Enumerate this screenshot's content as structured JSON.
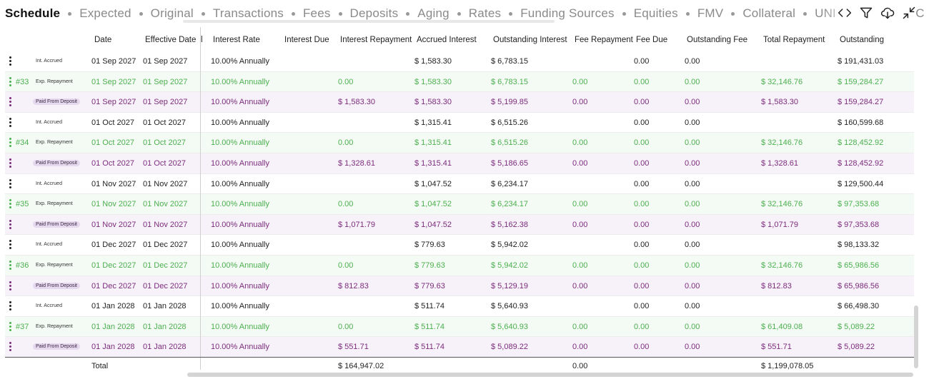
{
  "tabs": [
    {
      "label": "Schedule",
      "active": true
    },
    {
      "label": "Expected"
    },
    {
      "label": "Original"
    },
    {
      "label": "Transactions"
    },
    {
      "label": "Fees"
    },
    {
      "label": "Deposits"
    },
    {
      "label": "Aging"
    },
    {
      "label": "Rates"
    },
    {
      "label": "Funding Sources"
    },
    {
      "label": "Equities"
    },
    {
      "label": "FMV"
    },
    {
      "label": "Collateral"
    },
    {
      "label": "UNDERWRITING C"
    }
  ],
  "tools": [
    {
      "name": "code-view-icon"
    },
    {
      "name": "filter-icon"
    },
    {
      "name": "cloud-download-icon"
    },
    {
      "name": "collapse-icon"
    }
  ],
  "columns": {
    "date": "Date",
    "effective_date": "Effective Date",
    "partial": "l",
    "interest_rate": "Interest Rate",
    "interest_due": "Interest Due",
    "interest_repayment": "Interest Repayment",
    "accrued_interest": "Accrued Interest",
    "outstanding_interest": "Outstanding Interest",
    "fee_repayment": "Fee Repayment",
    "fee_due": "Fee Due",
    "outstanding_fee": "Outstanding Fee",
    "total_repayment": "Total Repayment",
    "outstanding": "Outstanding"
  },
  "badges": {
    "accrued": "Int. Accrued",
    "expected": "Exp. Repayment",
    "paid": "Paid From Deposit"
  },
  "rows": [
    {
      "type": "accrued",
      "num": "",
      "date": "01 Sep 2027",
      "eff": "01 Sep 2027",
      "rate": "10.00% Annually",
      "int_due": "",
      "int_repay": "",
      "accrued": "$ 1,583.30",
      "out_int": "$ 6,783.15",
      "fee_repay": "",
      "fee_due": "0.00",
      "out_fee": "0.00",
      "total_repay": "",
      "outstanding": "$ 191,431.03"
    },
    {
      "type": "expected",
      "num": "#33",
      "date": "01 Sep 2027",
      "eff": "01 Sep 2027",
      "rate": "10.00% Annually",
      "int_due": "",
      "int_repay": "0.00",
      "accrued": "$ 1,583.30",
      "out_int": "$ 6,783.15",
      "fee_repay": "0.00",
      "fee_due": "0.00",
      "out_fee": "0.00",
      "total_repay": "$ 32,146.76",
      "outstanding": "$ 159,284.27"
    },
    {
      "type": "paid",
      "num": "",
      "date": "01 Sep 2027",
      "eff": "01 Sep 2027",
      "rate": "10.00% Annually",
      "int_due": "",
      "int_repay": "$ 1,583.30",
      "accrued": "$ 1,583.30",
      "out_int": "$ 5,199.85",
      "fee_repay": "0.00",
      "fee_due": "0.00",
      "out_fee": "0.00",
      "total_repay": "$ 1,583.30",
      "outstanding": "$ 159,284.27"
    },
    {
      "type": "accrued",
      "num": "",
      "date": "01 Oct 2027",
      "eff": "01 Oct 2027",
      "rate": "10.00% Annually",
      "int_due": "",
      "int_repay": "",
      "accrued": "$ 1,315.41",
      "out_int": "$ 6,515.26",
      "fee_repay": "",
      "fee_due": "0.00",
      "out_fee": "0.00",
      "total_repay": "",
      "outstanding": "$ 160,599.68"
    },
    {
      "type": "expected",
      "num": "#34",
      "date": "01 Oct 2027",
      "eff": "01 Oct 2027",
      "rate": "10.00% Annually",
      "int_due": "",
      "int_repay": "0.00",
      "accrued": "$ 1,315.41",
      "out_int": "$ 6,515.26",
      "fee_repay": "0.00",
      "fee_due": "0.00",
      "out_fee": "0.00",
      "total_repay": "$ 32,146.76",
      "outstanding": "$ 128,452.92"
    },
    {
      "type": "paid",
      "num": "",
      "date": "01 Oct 2027",
      "eff": "01 Oct 2027",
      "rate": "10.00% Annually",
      "int_due": "",
      "int_repay": "$ 1,328.61",
      "accrued": "$ 1,315.41",
      "out_int": "$ 5,186.65",
      "fee_repay": "0.00",
      "fee_due": "0.00",
      "out_fee": "0.00",
      "total_repay": "$ 1,328.61",
      "outstanding": "$ 128,452.92"
    },
    {
      "type": "accrued",
      "num": "",
      "date": "01 Nov 2027",
      "eff": "01 Nov 2027",
      "rate": "10.00% Annually",
      "int_due": "",
      "int_repay": "",
      "accrued": "$ 1,047.52",
      "out_int": "$ 6,234.17",
      "fee_repay": "",
      "fee_due": "0.00",
      "out_fee": "0.00",
      "total_repay": "",
      "outstanding": "$ 129,500.44"
    },
    {
      "type": "expected",
      "num": "#35",
      "date": "01 Nov 2027",
      "eff": "01 Nov 2027",
      "rate": "10.00% Annually",
      "int_due": "",
      "int_repay": "0.00",
      "accrued": "$ 1,047.52",
      "out_int": "$ 6,234.17",
      "fee_repay": "0.00",
      "fee_due": "0.00",
      "out_fee": "0.00",
      "total_repay": "$ 32,146.76",
      "outstanding": "$ 97,353.68"
    },
    {
      "type": "paid",
      "num": "",
      "date": "01 Nov 2027",
      "eff": "01 Nov 2027",
      "rate": "10.00% Annually",
      "int_due": "",
      "int_repay": "$ 1,071.79",
      "accrued": "$ 1,047.52",
      "out_int": "$ 5,162.38",
      "fee_repay": "0.00",
      "fee_due": "0.00",
      "out_fee": "0.00",
      "total_repay": "$ 1,071.79",
      "outstanding": "$ 97,353.68"
    },
    {
      "type": "accrued",
      "num": "",
      "date": "01 Dec 2027",
      "eff": "01 Dec 2027",
      "rate": "10.00% Annually",
      "int_due": "",
      "int_repay": "",
      "accrued": "$ 779.63",
      "out_int": "$ 5,942.02",
      "fee_repay": "",
      "fee_due": "0.00",
      "out_fee": "0.00",
      "total_repay": "",
      "outstanding": "$ 98,133.32"
    },
    {
      "type": "expected",
      "num": "#36",
      "date": "01 Dec 2027",
      "eff": "01 Dec 2027",
      "rate": "10.00% Annually",
      "int_due": "",
      "int_repay": "0.00",
      "accrued": "$ 779.63",
      "out_int": "$ 5,942.02",
      "fee_repay": "0.00",
      "fee_due": "0.00",
      "out_fee": "0.00",
      "total_repay": "$ 32,146.76",
      "outstanding": "$ 65,986.56"
    },
    {
      "type": "paid",
      "num": "",
      "date": "01 Dec 2027",
      "eff": "01 Dec 2027",
      "rate": "10.00% Annually",
      "int_due": "",
      "int_repay": "$ 812.83",
      "accrued": "$ 779.63",
      "out_int": "$ 5,129.19",
      "fee_repay": "0.00",
      "fee_due": "0.00",
      "out_fee": "0.00",
      "total_repay": "$ 812.83",
      "outstanding": "$ 65,986.56"
    },
    {
      "type": "accrued",
      "num": "",
      "date": "01 Jan 2028",
      "eff": "01 Jan 2028",
      "rate": "10.00% Annually",
      "int_due": "",
      "int_repay": "",
      "accrued": "$ 511.74",
      "out_int": "$ 5,640.93",
      "fee_repay": "",
      "fee_due": "0.00",
      "out_fee": "0.00",
      "total_repay": "",
      "outstanding": "$ 66,498.30"
    },
    {
      "type": "expected",
      "num": "#37",
      "date": "01 Jan 2028",
      "eff": "01 Jan 2028",
      "rate": "10.00% Annually",
      "int_due": "",
      "int_repay": "0.00",
      "accrued": "$ 511.74",
      "out_int": "$ 5,640.93",
      "fee_repay": "0.00",
      "fee_due": "0.00",
      "out_fee": "0.00",
      "total_repay": "$ 61,409.08",
      "outstanding": "$ 5,089.22"
    },
    {
      "type": "paid",
      "num": "",
      "date": "01 Jan 2028",
      "eff": "01 Jan 2028",
      "rate": "10.00% Annually",
      "int_due": "",
      "int_repay": "$ 551.71",
      "accrued": "$ 511.74",
      "out_int": "$ 5,089.22",
      "fee_repay": "0.00",
      "fee_due": "0.00",
      "out_fee": "0.00",
      "total_repay": "$ 551.71",
      "outstanding": "$ 5,089.22"
    }
  ],
  "totals": {
    "label": "Total",
    "interest_repayment": "$ 164,947.02",
    "fee_repayment": "0.00",
    "total_repayment": "$ 1,199,078.05"
  }
}
